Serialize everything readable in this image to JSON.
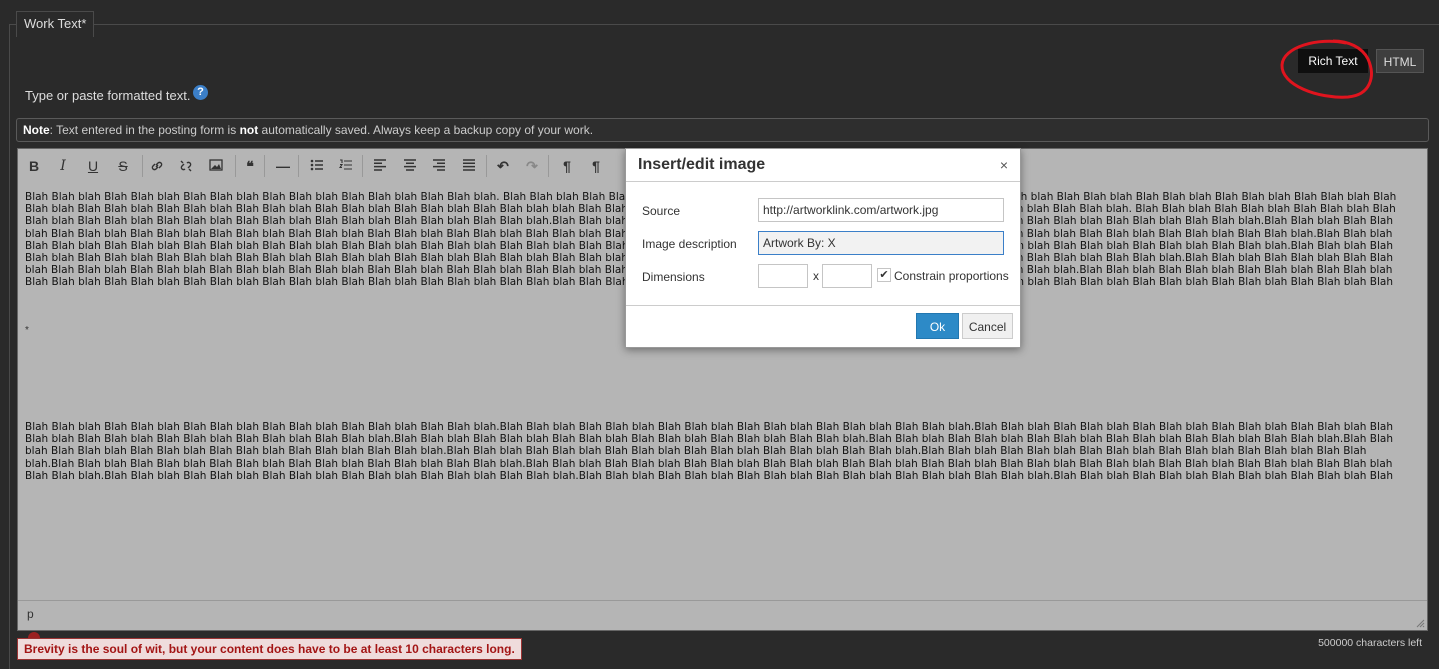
{
  "field": {
    "legend": "Work Text*",
    "instructions": "Type or paste formatted text.",
    "help_glyph": "?"
  },
  "mode_toggle": {
    "rich_text": "Rich Text",
    "html": "HTML",
    "annotation_color": "#e0141e"
  },
  "note": {
    "lead": "Note",
    "text_a": ": Text entered in the posting form is ",
    "emphasis": "not",
    "text_b": " automatically saved. Always keep a backup copy of your work."
  },
  "toolbar": {
    "buttons": [
      {
        "name": "bold-icon",
        "glyph": "B"
      },
      {
        "name": "italic-icon",
        "glyph": "I"
      },
      {
        "name": "underline-icon",
        "glyph": "U"
      },
      {
        "name": "strikethrough-icon",
        "glyph": "S"
      },
      {
        "name": "link-icon",
        "glyph": ""
      },
      {
        "name": "unlink-icon",
        "glyph": ""
      },
      {
        "name": "image-icon",
        "glyph": ""
      },
      {
        "name": "blockquote-icon",
        "glyph": "❝"
      },
      {
        "name": "horizontal-rule-icon",
        "glyph": "—"
      },
      {
        "name": "bullet-list-icon",
        "glyph": ""
      },
      {
        "name": "numbered-list-icon",
        "glyph": ""
      },
      {
        "name": "align-left-icon",
        "glyph": ""
      },
      {
        "name": "align-center-icon",
        "glyph": ""
      },
      {
        "name": "align-right-icon",
        "glyph": ""
      },
      {
        "name": "align-justify-icon",
        "glyph": ""
      },
      {
        "name": "undo-icon",
        "glyph": "↶"
      },
      {
        "name": "redo-icon",
        "glyph": "↷"
      },
      {
        "name": "ltr-icon",
        "glyph": "¶"
      },
      {
        "name": "rtl-icon",
        "glyph": "¶"
      }
    ]
  },
  "editor": {
    "paragraph1": "Blah Blah blah Blah Blah blah Blah Blah blah Blah Blah blah Blah Blah blah Blah Blah blah. Blah Blah blah Blah Blah blah Blah Blah blah Blah Blah blah Blah Blah blah Blah Blah blah Blah Blah blah Blah Blah blah Blah Blah blah Blah Blah blah Blah Blah blah Blah Blah blah Blah Blah blah Blah Blah blah Blah Blah blah Blah Blah blah Blah Blah blah Blah Blah blah blah Blah Blah blah.Blah Blah blah Blah Blah blah Blah Blah blah Blah Blah blah Blah Blah blah Blah Blah blah. Blah Blah blah Blah Blah blah Blah Blah blah Blah Blah blah Blah Blah blah Blah Blah blah Blah Blah blah Blah Blah blah Blah Blah blah Blah Blah blah.Blah Blah blah Blah Blah blah Blah Blah blah Blah Blah blah Blah Blah blah Blah Blah blah Blah Blah blah Blah Blah blah Blah Blah blah.Blah Blah blah Blah Blah blah Blah Blah blah Blah Blah blah Blah Blah blah Blah Blah blah Blah Blah blah Blah Blah blah Blah Blah blah Blah Blah blah Blah Blah blah Blah Blah blah Blah Blah blah Blah Blah blah Blah Blah blah Blah Blah blah Blah Blah blah Blah Blah blah.Blah Blah blah Blah Blah blah Blah Blah blah Blah Blah blah Blah Blah blah Blah Blah blah Blah Blah blah Blah Blah blah Blah Blah blah Blah Blah blah Blah Blah blah Blah Blah blah Blah Blah blah Blah Blah blah Blah Blah blah Blah Blah blah Blah Blah blah.Blah Blah blah Blah Blah blah Blah Blah blah Blah Blah blah Blah Blah blah Blah Blah blah Blah Blah blah Blah Blah blah Blah Blah blah Blah Blah blah Blah Blah blah Blah Blah blah Blah Blah blah Blah Blah blah Blah Blah blah Blah Blah blah.Blah Blah blah Blah Blah blah Blah Blah blah Blah Blah blah Blah Blah blah Blah Blah blah Blah Blah blah Blah Blah blah Blah Blah blah Blah Blah blah Blah Blah blah Blah Blah blah Blah Blah blah Blah Blah blah Blah Blah blah Blah Blah blah.Blah Blah blah Blah Blah blah Blah Blah blah Blah Blah blah Blah Blah blah Blah Blah blah Blah Blah blah Blah Blah blah Blah Blah blah Blah Blah blah Blah Blah blah Blah Blah blah Blah Blah blah Blah Blah blah Blah Blah blah Blah Blah blah Blah Blah blah Blah Blah blah Blah Blah blah Blah Blah blah Blah Blah blah Blah Blah blah Blah Blah blah Blah Blah blah Blah Blah blah.Blah Blah blah Blah Blah blah Blah Blah blah Blah Blah blah Blah Blah blah Blah Blah blah Blah Blah blah Blah Blah blah Blah Blah blah Blah Blah blah Blah Blah blah Blah Blah blah Blah Blah blah Blah Blah blah Blah Blah blah Blah Blah blah Blah Blah blah.Blah Blah blah Blah Blah blah Blah Blah blah Blah Blah blah Blah Blah blah Blah Blah blah Blah Blah blah Blah Blah blah Blah Blah blah Blah Blah blah Blah Blah blah Blah Blah blah Blah Blah blah Blah Blah blah Blah Blah blah Blah Blah blah blah Blah Blah blah.Blah Blah blah Blah Blah blah Blah Blah blah Blah Blah blah Blah Blah blah Blah Blah blah Blah Blah blah Blah Blah blah Blah Blah blah Blah Blah blah Blah Blah blah.",
    "paragraph_marker": "*",
    "paragraph2": "Blah Blah blah Blah Blah blah Blah Blah blah Blah Blah blah Blah Blah blah Blah Blah blah.Blah Blah blah Blah Blah blah Blah Blah blah Blah Blah blah Blah Blah blah Blah Blah blah.Blah Blah blah Blah Blah blah Blah Blah blah Blah Blah blah Blah Blah blah Blah Blah blah Blah Blah blah Blah Blah blah Blah Blah blah Blah Blah blah.Blah Blah blah Blah Blah blah Blah Blah blah Blah Blah blah Blah Blah blah Blah Blah blah.Blah Blah blah Blah Blah blah Blah Blah blah Blah Blah blah Blah Blah blah Blah Blah blah.Blah Blah blah Blah Blah blah Blah Blah blah Blah Blah blah Blah Blah blah Blah Blah blah.Blah Blah blah Blah Blah blah Blah Blah blah Blah Blah blah Blah Blah blah Blah Blah blah.Blah Blah blah Blah Blah blah Blah Blah blah Blah Blah blah Blah Blah blah Blah Blah blah.Blah Blah blah Blah Blah blah Blah Blah blah Blah Blah blah Blah Blah blah Blah Blah blah.Blah Blah blah Blah Blah blah Blah Blah blah Blah Blah blah Blah Blah blah Blah Blah blah Blah Blah blah Blah Blah blah Blah Blah blah Blah Blah blah Blah Blah blah Blah Blah blah.Blah Blah blah Blah Blah blah Blah Blah blah Blah Blah blah Blah Blah blah Blah Blah blah.Blah Blah blah Blah Blah blah Blah Blah blah Blah Blah blah Blah Blah blah Blah Blah blah.Blah Blah blah Blah Blah blah Blah Blah blah Blah Blah blah Blah Blah blah Blah Blah blah.Blah Blah blah Blah Blah blah Blah Blah blah Blah Blah blah Blah Blah blah Blah Blah blah.Blah Blah blah Blah Blah blah Blah Blah blah Blah Blah blah Blah Blah blah Blah Blah blah.Blah Blah blah Blah Blah blah Blah Blah blah Blah Blah blah Blah Blah blah Blah Blah blah Blah Blah blah Blah Blah blah Blah Blah blah Blah Blah blah.",
    "path": "p"
  },
  "validation": {
    "error": "Brevity is the soul of wit, but your content does have to be at least 10 characters long.",
    "chars_left": "500000 characters left"
  },
  "dialog": {
    "title": "Insert/edit image",
    "close_glyph": "×",
    "source_label": "Source",
    "source_value": "http://artworklink.com/artwork.jpg",
    "description_label": "Image description",
    "description_value": "Artwork By: X",
    "dimensions_label": "Dimensions",
    "width_value": "",
    "height_value": "",
    "dims_separator": "x",
    "constrain_label": "Constrain proportions",
    "constrain_checked": "✔",
    "ok_label": "Ok",
    "cancel_label": "Cancel"
  },
  "colors": {
    "page_bg": "#2a2a2a",
    "editor_bg": "#b5b5b5",
    "ok_button": "#2d8ac7",
    "error_text": "#a31515"
  }
}
